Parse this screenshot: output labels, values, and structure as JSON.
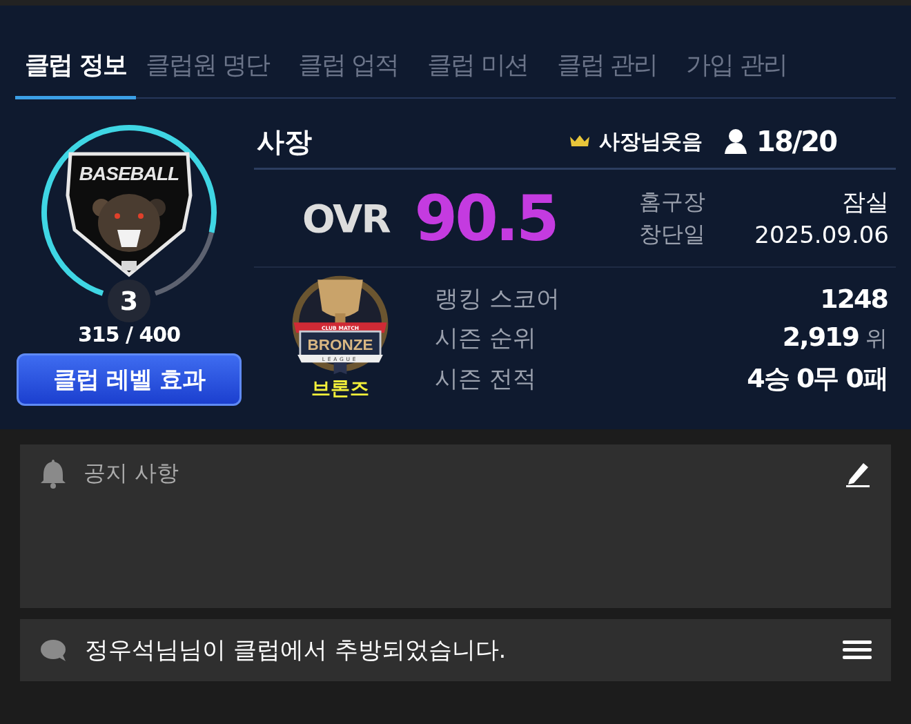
{
  "tabs": [
    {
      "label": "클럽 정보",
      "selected": true
    },
    {
      "label": "클럽원 명단",
      "selected": false
    },
    {
      "label": "클럽 업적",
      "selected": false
    },
    {
      "label": "클럽 미션",
      "selected": false
    },
    {
      "label": "클럽 관리",
      "selected": false
    },
    {
      "label": "가입 관리",
      "selected": false
    }
  ],
  "club": {
    "emblem_title": "BASEBALL",
    "club_level": "3",
    "exp": "315 / 400",
    "level_button": "클럽 레벨 효과",
    "role": "사장",
    "owner": "사장님웃음",
    "members": "18/20",
    "ovr_label": "OVR",
    "ovr": "90.5",
    "info": [
      {
        "label": "홈구장",
        "value": "잠실"
      },
      {
        "label": "창단일",
        "value": "2025.09.06"
      }
    ],
    "league": {
      "banner": "CLUB MATCH",
      "name": "BRONZE",
      "subtitle": "LEAGUE",
      "label": "브론즈"
    },
    "stats": [
      {
        "label": "랭킹 스코어",
        "value": "1248"
      },
      {
        "label": "시즌 순위",
        "value": "2,919",
        "unit": "위"
      },
      {
        "label": "시즌 전적",
        "value": "4승 0무 0패"
      }
    ]
  },
  "notice": {
    "title": "공지 사항"
  },
  "message": {
    "text": "정우석님님이 클럽에서 추방되었습니다."
  }
}
